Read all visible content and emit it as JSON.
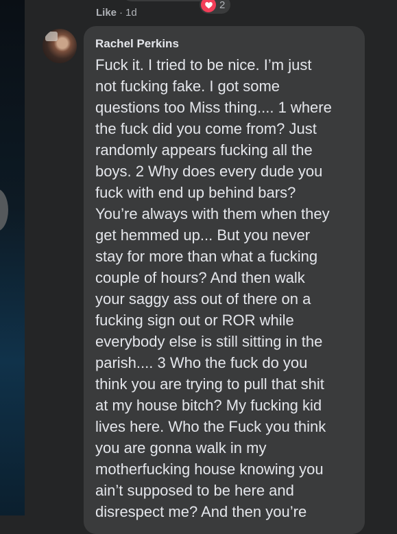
{
  "previous_comment": {
    "actions": {
      "like_label": "Like",
      "separator": "·",
      "age": "1d"
    },
    "reactions": {
      "icon": "heart-icon",
      "count": "2",
      "color": "#f33e58"
    }
  },
  "comment": {
    "author": "Rachel Perkins",
    "lines": [
      "Fuck it. I tried to be nice. I’m just",
      "not fucking fake. I got some",
      "questions too Miss thing.... 1 where",
      "the fuck did you come from? Just",
      "randomly appears fucking all the",
      "boys. 2 Why does every dude you",
      "fuck with end up behind bars?",
      "You’re always with them when they",
      "get hemmed up... But you never",
      "stay for more than what a fucking",
      "couple of hours? And then walk",
      "your saggy ass out of there on a",
      "fucking sign out or ROR while",
      "everybody else is still sitting in the",
      "parish.... 3 Who the fuck do you",
      "think you are trying to pull that shit",
      "at my house bitch? My fucking kid",
      "lives here. Who the Fuck you think",
      "you are gonna walk in my",
      "motherfucking house knowing you",
      "ain’t supposed to be here and",
      "disrespect me? And then you’re"
    ]
  },
  "theme": {
    "background": "#242526",
    "bubble": "#3a3b3c",
    "text": "#e4e6eb",
    "muted": "#b0b3b8"
  }
}
